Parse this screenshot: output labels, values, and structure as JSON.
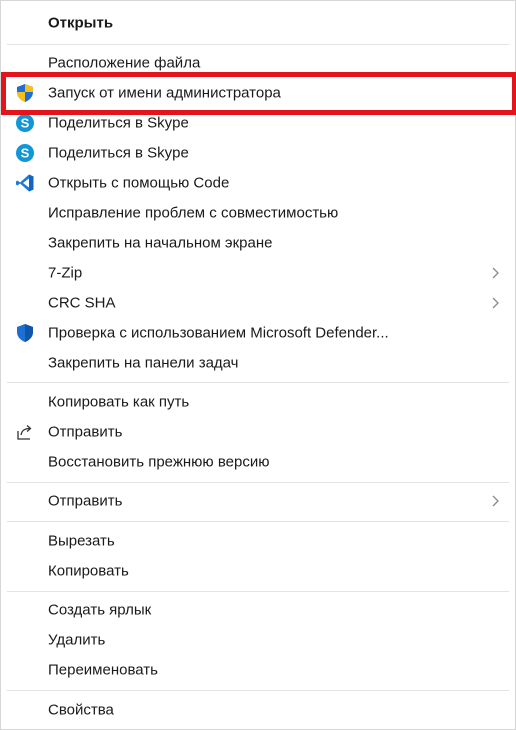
{
  "menu": {
    "open": "Открыть",
    "file_location": "Расположение файла",
    "run_as_admin": "Запуск от имени администратора",
    "share_skype_1": "Поделиться в Skype",
    "share_skype_2": "Поделиться в Skype",
    "open_with_code": "Открыть с помощью Code",
    "troubleshoot": "Исправление проблем с совместимостью",
    "pin_start": "Закрепить на начальном экране",
    "sevenzip": "7-Zip",
    "crc_sha": "CRC SHA",
    "defender_scan": "Проверка с использованием Microsoft Defender...",
    "pin_taskbar": "Закрепить на панели задач",
    "copy_as_path": "Копировать как путь",
    "share": "Отправить",
    "restore_previous": "Восстановить прежнюю версию",
    "send_to": "Отправить",
    "cut": "Вырезать",
    "copy": "Копировать",
    "create_shortcut": "Создать ярлык",
    "delete": "Удалить",
    "rename": "Переименовать",
    "properties": "Свойства"
  },
  "colors": {
    "highlight_border": "#e3141b",
    "skype": "#1196d8",
    "vscode": "#1f7bd6",
    "shield_blue": "#1d6fd1",
    "shield_yellow": "#f4c020"
  },
  "icons": [
    "uac-shield-icon",
    "skype-icon",
    "vscode-icon",
    "defender-shield-icon",
    "share-icon",
    "chevron-right-icon"
  ]
}
